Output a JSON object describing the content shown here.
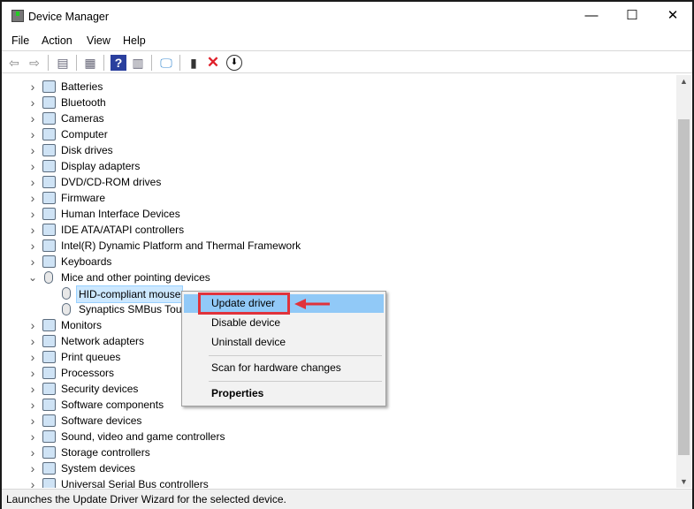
{
  "window": {
    "title": "Device Manager",
    "minimize": "—",
    "maximize": "☐",
    "close": "✕"
  },
  "menu": [
    "File",
    "Action",
    "View",
    "Help"
  ],
  "toolbar": [
    "back-icon",
    "forward-icon",
    "show-hide-tree-icon",
    "properties-icon",
    "help-icon",
    "action-pane-icon",
    "scan-hardware-icon",
    "update-driver-icon",
    "uninstall-icon",
    "download-icon"
  ],
  "tree": [
    {
      "label": "Batteries"
    },
    {
      "label": "Bluetooth"
    },
    {
      "label": "Cameras"
    },
    {
      "label": "Computer"
    },
    {
      "label": "Disk drives"
    },
    {
      "label": "Display adapters"
    },
    {
      "label": "DVD/CD-ROM drives"
    },
    {
      "label": "Firmware"
    },
    {
      "label": "Human Interface Devices"
    },
    {
      "label": "IDE ATA/ATAPI controllers"
    },
    {
      "label": "Intel(R) Dynamic Platform and Thermal Framework"
    },
    {
      "label": "Keyboards"
    },
    {
      "label": "Mice and other pointing devices",
      "expanded": true
    },
    {
      "label": "HID-compliant mouse",
      "child": true,
      "selected": true
    },
    {
      "label": "Synaptics SMBus TouchPad",
      "child": true
    },
    {
      "label": "Monitors"
    },
    {
      "label": "Network adapters"
    },
    {
      "label": "Print queues"
    },
    {
      "label": "Processors"
    },
    {
      "label": "Security devices"
    },
    {
      "label": "Software components"
    },
    {
      "label": "Software devices"
    },
    {
      "label": "Sound, video and game controllers"
    },
    {
      "label": "Storage controllers"
    },
    {
      "label": "System devices"
    },
    {
      "label": "Universal Serial Bus controllers"
    }
  ],
  "context_menu": {
    "update": "Update driver",
    "disable": "Disable device",
    "uninstall": "Uninstall device",
    "scan": "Scan for hardware changes",
    "properties": "Properties"
  },
  "status": "Launches the Update Driver Wizard for the selected device.",
  "colors": {
    "highlight": "#91c9f7",
    "annotation": "#e0333b"
  }
}
